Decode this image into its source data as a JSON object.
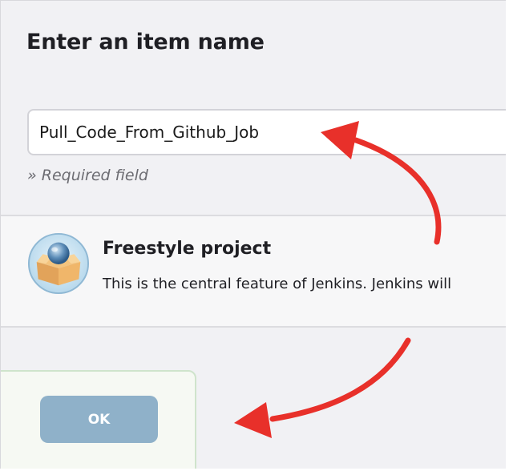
{
  "page": {
    "title": "Enter an item name"
  },
  "item_name": {
    "value": "Pull_Code_From_Github_Job",
    "required_note": "» Required field"
  },
  "project_types": [
    {
      "name": "Freestyle project",
      "description": "This is the central feature of Jenkins. Jenkins will",
      "icon": "freestyle-project-icon"
    }
  ],
  "actions": {
    "ok_label": "OK"
  },
  "annotations": {
    "arrow_color": "#e8302a"
  },
  "colors": {
    "ok_button": "#8fb1c9",
    "panel_border": "#cfe4cc",
    "background": "#f1f1f4"
  }
}
